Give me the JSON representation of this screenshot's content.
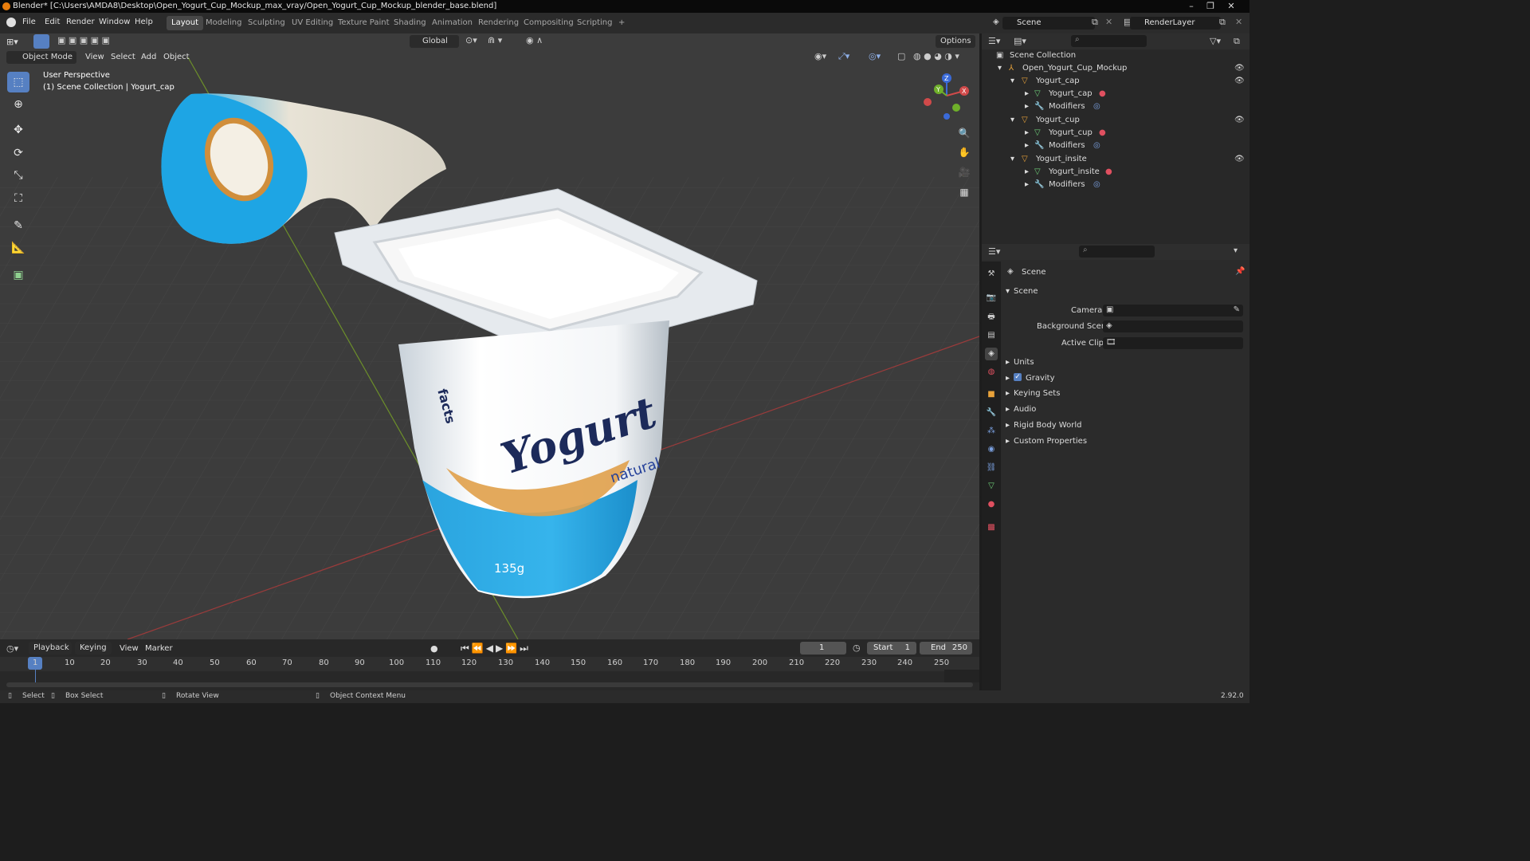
{
  "window": {
    "title": "Blender* [C:\\Users\\AMDA8\\Desktop\\Open_Yogurt_Cup_Mockup_max_vray/Open_Yogurt_Cup_Mockup_blender_base.blend]"
  },
  "menu": {
    "file": "File",
    "edit": "Edit",
    "render": "Render",
    "window": "Window",
    "help": "Help"
  },
  "workspaces": [
    "Layout",
    "Modeling",
    "Sculpting",
    "UV Editing",
    "Texture Paint",
    "Shading",
    "Animation",
    "Rendering",
    "Compositing",
    "Scripting"
  ],
  "workspace_add": "+",
  "top_right": {
    "scene": "Scene",
    "render_layer": "RenderLayer"
  },
  "viewport": {
    "mode": "Object Mode",
    "menus": [
      "View",
      "Select",
      "Add",
      "Object"
    ],
    "transform_orientation": "Global",
    "options": "Options",
    "perspective": "User Perspective",
    "context": "(1) Scene Collection | Yogurt_cap",
    "axis_x": "X",
    "axis_y": "Y",
    "axis_z": "Z",
    "product": {
      "brand": "Yogurt",
      "variant": "natural",
      "weight": "135g",
      "side_text": "facts"
    }
  },
  "outliner": {
    "root": "Scene Collection",
    "collection": "Open_Yogurt_Cup_Mockup",
    "items": [
      {
        "name": "Yogurt_cap",
        "mesh": "Yogurt_cap",
        "modifiers": "Modifiers"
      },
      {
        "name": "Yogurt_cup",
        "mesh": "Yogurt_cup",
        "modifiers": "Modifiers"
      },
      {
        "name": "Yogurt_insite",
        "mesh": "Yogurt_insite",
        "modifiers": "Modifiers"
      }
    ]
  },
  "properties": {
    "breadcrumb": "Scene",
    "panel": "Scene",
    "camera_label": "Camera",
    "background_scene_label": "Background Scene",
    "active_clip_label": "Active Clip",
    "sections": [
      "Units",
      "Gravity",
      "Keying Sets",
      "Audio",
      "Rigid Body World",
      "Custom Properties"
    ],
    "gravity_checked": true
  },
  "timeline": {
    "menus": [
      "Playback",
      "Keying",
      "View",
      "Marker"
    ],
    "current_frame": "1",
    "start_label": "Start",
    "start": "1",
    "end_label": "End",
    "end": "250",
    "ticks": [
      "1",
      "10",
      "20",
      "30",
      "40",
      "50",
      "60",
      "70",
      "80",
      "90",
      "100",
      "110",
      "120",
      "130",
      "140",
      "150",
      "160",
      "170",
      "180",
      "190",
      "200",
      "210",
      "220",
      "230",
      "240",
      "250"
    ]
  },
  "statusbar": {
    "select": "Select",
    "box_select": "Box Select",
    "rotate": "Rotate View",
    "context_menu": "Object Context Menu",
    "version": "2.92.0"
  },
  "colors": {
    "accent": "#5680c2",
    "brand_blue": "#29a8e0",
    "navy": "#1c2a5a",
    "orange": "#e87d0d"
  }
}
